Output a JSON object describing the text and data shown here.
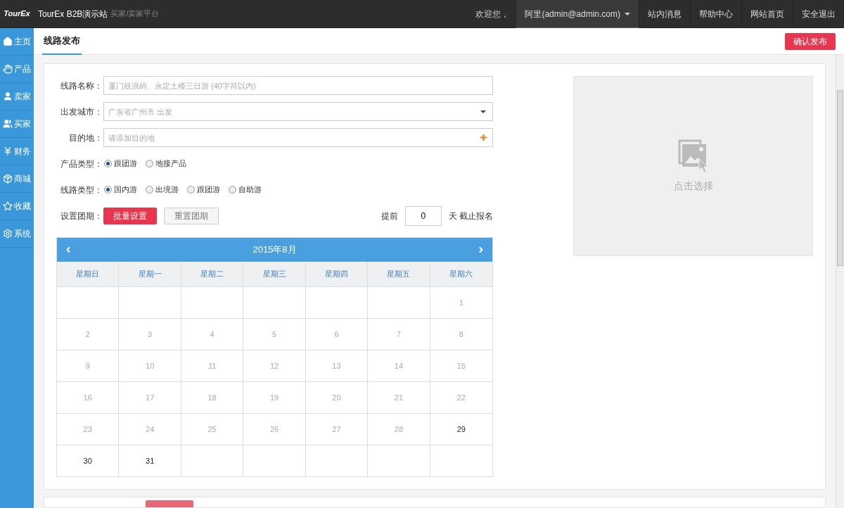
{
  "topbar": {
    "logo": "TourEx",
    "site_title": "TourEx B2B演示站",
    "subtitle": "买家/卖家平台",
    "welcome": "欢迎您，",
    "user_menu": "阿里(admin@admin.com)",
    "links": [
      "站内消息",
      "帮助中心",
      "网站首页",
      "安全退出"
    ]
  },
  "sidebar": {
    "items": [
      {
        "label": "主页",
        "selected": false
      },
      {
        "label": "产品",
        "selected": false
      },
      {
        "label": "卖家",
        "selected": false
      },
      {
        "label": "买家",
        "selected": false
      },
      {
        "label": "财务",
        "selected": false
      },
      {
        "label": "商城",
        "selected": false
      },
      {
        "label": "收藏",
        "selected": false
      },
      {
        "label": "系统",
        "selected": false
      }
    ]
  },
  "page": {
    "tab": "线路发布",
    "publish_button": "确认发布"
  },
  "form": {
    "fields": [
      {
        "label": "线路名称：",
        "kind": "text",
        "placeholder": "厦门鼓浪屿、永定土楼三日游 (40字符以内)"
      },
      {
        "label": "出发城市：",
        "kind": "select",
        "placeholder": "广东省广州市 出发"
      },
      {
        "label": "目的地：",
        "kind": "add",
        "placeholder": "请添加目的地"
      }
    ],
    "radio_groups": [
      {
        "label": "产品类型：",
        "options": [
          {
            "label": "跟团游",
            "selected": true
          },
          {
            "label": "地接产品",
            "selected": false
          }
        ]
      },
      {
        "label": "线路类型：",
        "options": [
          {
            "label": "国内游",
            "selected": true
          },
          {
            "label": "出境游",
            "selected": false
          },
          {
            "label": "跟团游",
            "selected": false
          },
          {
            "label": "自助游",
            "selected": false
          }
        ]
      }
    ],
    "schedule": {
      "label": "设置团期：",
      "batch_button": "批量设置",
      "reset_button": "重置团期",
      "advance_label": "提前",
      "advance_value": "0",
      "deadline_label": "天 截止报名"
    }
  },
  "calendar": {
    "month": "2015年8月",
    "weekdays": [
      "星期日",
      "星期一",
      "星期二",
      "星期三",
      "星期四",
      "星期五",
      "星期六"
    ],
    "weeks": [
      [
        {
          "kind": "empty"
        },
        {
          "kind": "empty"
        },
        {
          "kind": "empty"
        },
        {
          "kind": "empty"
        },
        {
          "kind": "empty"
        },
        {
          "kind": "empty"
        },
        {
          "kind": "day",
          "day": "1",
          "disabled": true
        }
      ],
      [
        {
          "kind": "day",
          "day": "2",
          "disabled": true
        },
        {
          "kind": "day",
          "day": "3",
          "disabled": true
        },
        {
          "kind": "day",
          "day": "4",
          "disabled": true
        },
        {
          "kind": "day",
          "day": "5",
          "disabled": true
        },
        {
          "kind": "day",
          "day": "6",
          "disabled": true
        },
        {
          "kind": "day",
          "day": "7",
          "disabled": true
        },
        {
          "kind": "day",
          "day": "8",
          "disabled": true
        }
      ],
      [
        {
          "kind": "day",
          "day": "9",
          "disabled": true
        },
        {
          "kind": "day",
          "day": "10",
          "disabled": true
        },
        {
          "kind": "day",
          "day": "11",
          "disabled": true
        },
        {
          "kind": "day",
          "day": "12",
          "disabled": true
        },
        {
          "kind": "day",
          "day": "13",
          "disabled": true
        },
        {
          "kind": "day",
          "day": "14",
          "disabled": true
        },
        {
          "kind": "day",
          "day": "15",
          "disabled": true
        }
      ],
      [
        {
          "kind": "day",
          "day": "16",
          "disabled": true
        },
        {
          "kind": "day",
          "day": "17",
          "disabled": true
        },
        {
          "kind": "day",
          "day": "18",
          "disabled": true
        },
        {
          "kind": "day",
          "day": "19",
          "disabled": true
        },
        {
          "kind": "day",
          "day": "20",
          "disabled": true
        },
        {
          "kind": "day",
          "day": "21",
          "disabled": true
        },
        {
          "kind": "day",
          "day": "22",
          "disabled": true
        }
      ],
      [
        {
          "kind": "day",
          "day": "23",
          "disabled": true
        },
        {
          "kind": "day",
          "day": "24",
          "disabled": true
        },
        {
          "kind": "day",
          "day": "25",
          "disabled": true
        },
        {
          "kind": "day",
          "day": "26",
          "disabled": true
        },
        {
          "kind": "day",
          "day": "27",
          "disabled": true
        },
        {
          "kind": "day",
          "day": "28",
          "disabled": true
        },
        {
          "kind": "day",
          "day": "29",
          "disabled": false
        }
      ],
      [
        {
          "kind": "day",
          "day": "30",
          "disabled": false
        },
        {
          "kind": "day",
          "day": "31",
          "disabled": false
        },
        {
          "kind": "empty"
        },
        {
          "kind": "empty"
        },
        {
          "kind": "empty"
        },
        {
          "kind": "empty"
        },
        {
          "kind": "empty"
        }
      ]
    ]
  },
  "image_picker": {
    "label": "点击选择"
  }
}
